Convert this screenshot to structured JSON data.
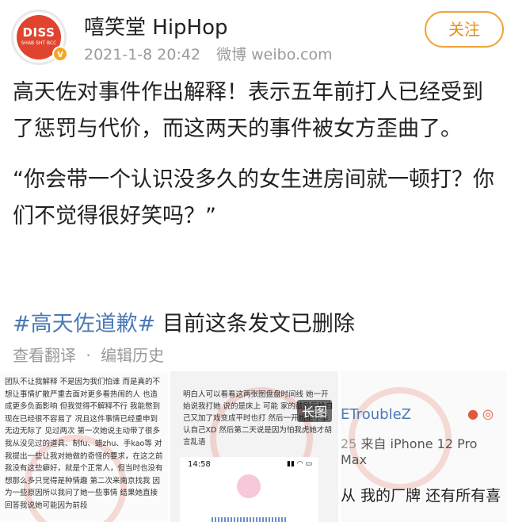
{
  "header": {
    "avatar_text": "DISS",
    "avatar_subtext": "SHAB SHT BCC",
    "username": "嘻笑堂 HipHop",
    "date": "2021-1-8 20:42",
    "source": "微博 weibo.com",
    "follow_label": "关注"
  },
  "post": {
    "paragraph1": "高天佐对事件作出解释！表示五年前打人已经受到了惩罚与代价，而这两天的事件被女方歪曲了。",
    "paragraph2": "“你会带一个认识没多久的女生进房间就一顿打？你们不觉得很好笑吗？”",
    "topic": "#高天佐道歉#",
    "topic_suffix": " 目前这条发文已删除"
  },
  "actions": {
    "translate": "查看翻译",
    "separator": "·",
    "history": "编辑历史"
  },
  "images": {
    "img1_text": "团队不让我解释 不是因为我们怕谁 而是真的不想让事情扩散严重去面对更多看热闹的人 也造成更多负面影响 但我觉得不解释不行 我能憋到现在已经很不容易了 况且这件事情已经重申到无边无际了 见过两次 第一次她说主动带了很多我从没见过的道具、制fu、蜡zhu、手kao等 对我提出一些让我对她做的奇怪的要求，在这之前我没有这些癖好，就是个正常人，但当时也没有想那么多只觉得是种情趣 第二次来南京找我 因为一些原因所以我问了她一些事情 结果她直接回答我说她可能因为前段",
    "img2_text": "明白人可以看看这两张图盘盘时间线 她一开始说我打她 说的是床上 可能 家的鼓励后给自己又加了戏变成平时也打 然后一开始拒不承认自己XD 然后第二天说是因为怕我虎她才胡言乱语",
    "img2_badge": "长图",
    "phone_time": "14:58",
    "img3_user": "ETroubleZ",
    "img3_source_prefix": "25",
    "img3_source": "来自 iPhone 12 Pro Max",
    "img3_text": "从 我的厂牌 还有所有喜"
  }
}
